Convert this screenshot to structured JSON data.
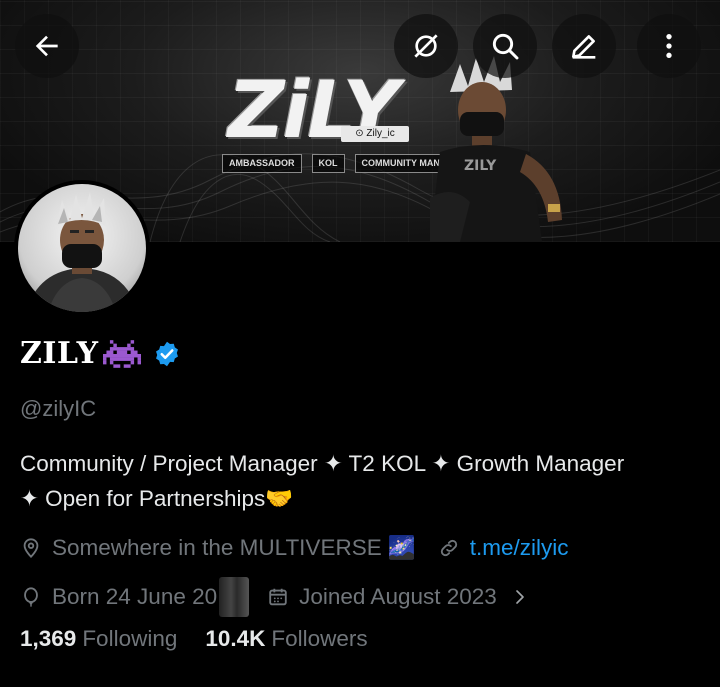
{
  "banner": {
    "logo_text": "ZiLY",
    "logo_handle": "Zily_ic",
    "tags": [
      "AMBASSADOR",
      "KOL",
      "COMMUNITY MANAGER"
    ],
    "shirt_text": "ZILY"
  },
  "nav": {
    "icons": [
      "back-arrow-icon",
      "grok-icon",
      "search-icon",
      "edit-icon",
      "more-vertical-icon"
    ]
  },
  "profile": {
    "name": "ZILY",
    "handle": "@zilyIC",
    "bio_line1": "Community / Project Manager ✦ T2 KOL ✦  Growth Manager",
    "bio_line2": "✦ Open for Partnerships🤝",
    "location": "Somewhere in the MULTIVERSE",
    "location_emoji": "🌌",
    "website": "t.me/zilyic",
    "born": "Born 24 June 20",
    "joined": "Joined August 2023",
    "following_count": "1,369",
    "following_label": "Following",
    "followers_count": "10.4K",
    "followers_label": "Followers"
  },
  "colors": {
    "background": "#000000",
    "primary_text": "#e7e9ea",
    "secondary_text": "#71767b",
    "link": "#1d9bf0",
    "verified": "#1d9bf0"
  }
}
